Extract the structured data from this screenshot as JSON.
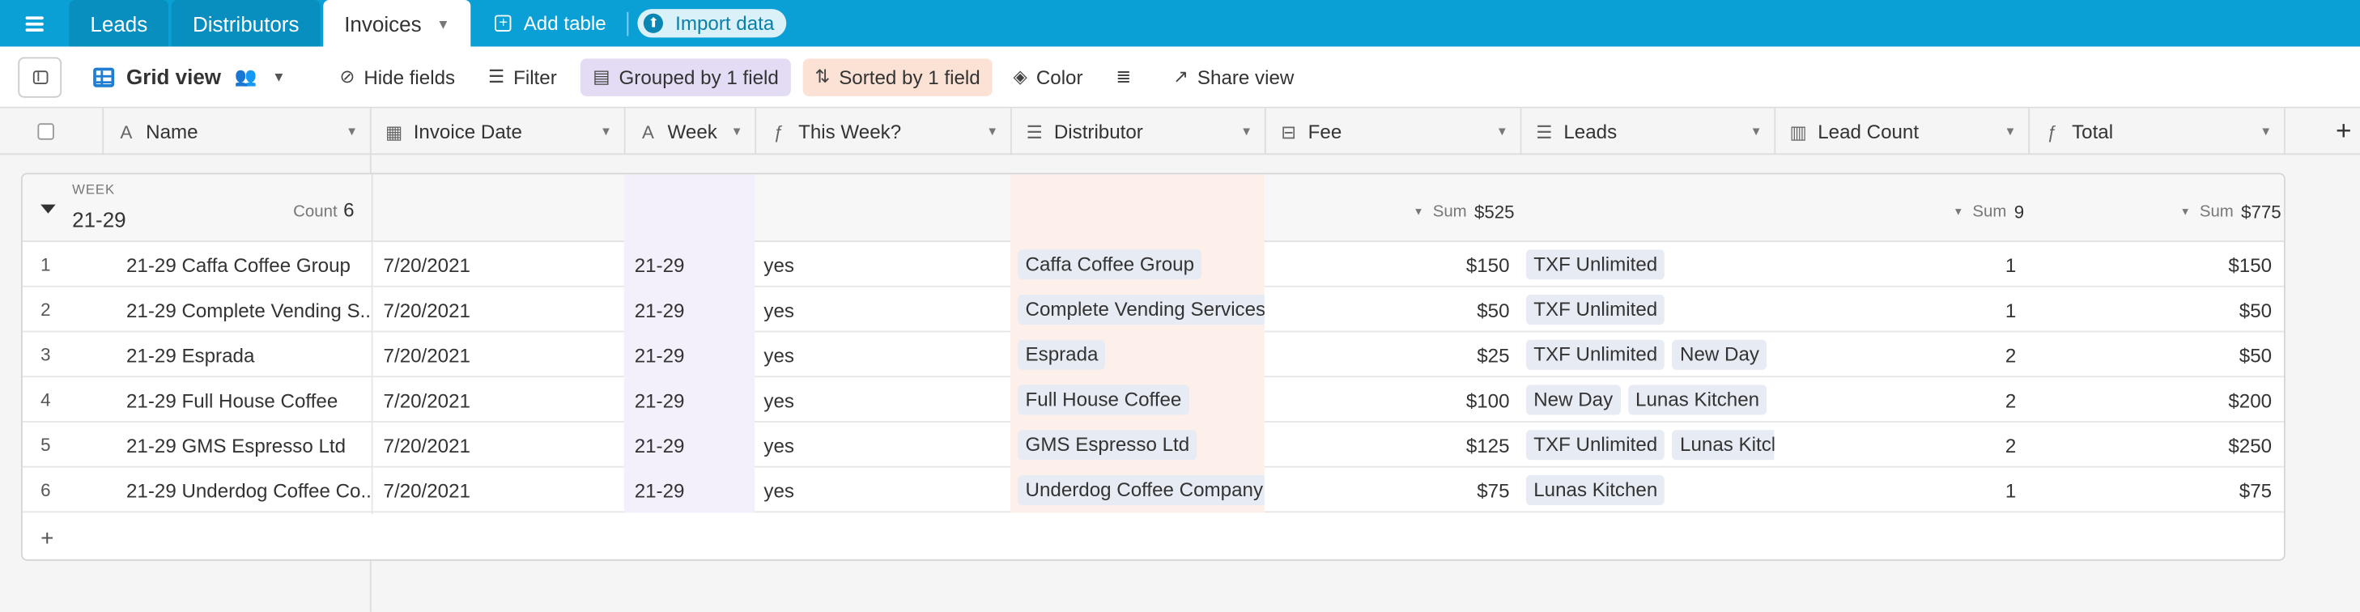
{
  "tabs": [
    {
      "label": "Leads"
    },
    {
      "label": "Distributors"
    },
    {
      "label": "Invoices"
    }
  ],
  "add_table_label": "Add table",
  "import_label": "Import data",
  "view": {
    "name": "Grid view",
    "hide_fields": "Hide fields",
    "filter": "Filter",
    "grouped": "Grouped by 1 field",
    "sorted": "Sorted by 1 field",
    "color": "Color",
    "share": "Share view"
  },
  "columns": {
    "name": "Name",
    "invoice_date": "Invoice Date",
    "week": "Week",
    "this_week": "This Week?",
    "distributor": "Distributor",
    "fee": "Fee",
    "leads": "Leads",
    "lead_count": "Lead Count",
    "total": "Total"
  },
  "group": {
    "label": "WEEK",
    "value": "21-29",
    "count_label": "Count",
    "count": "6",
    "sum_label": "Sum",
    "fee_sum": "$525",
    "lead_count_sum": "9",
    "total_sum": "$775"
  },
  "rows": [
    {
      "n": "1",
      "name": "21-29 Caffa Coffee Group",
      "date": "7/20/2021",
      "week": "21-29",
      "this_week": "yes",
      "distributor": "Caffa Coffee Group",
      "fee": "$150",
      "leads": [
        "TXF Unlimited"
      ],
      "lead_count": "1",
      "total": "$150"
    },
    {
      "n": "2",
      "name": "21-29 Complete Vending S...",
      "date": "7/20/2021",
      "week": "21-29",
      "this_week": "yes",
      "distributor": "Complete Vending Services",
      "fee": "$50",
      "leads": [
        "TXF Unlimited"
      ],
      "lead_count": "1",
      "total": "$50"
    },
    {
      "n": "3",
      "name": "21-29 Esprada",
      "date": "7/20/2021",
      "week": "21-29",
      "this_week": "yes",
      "distributor": "Esprada",
      "fee": "$25",
      "leads": [
        "TXF Unlimited",
        "New Day"
      ],
      "lead_count": "2",
      "total": "$50"
    },
    {
      "n": "4",
      "name": "21-29 Full House Coffee",
      "date": "7/20/2021",
      "week": "21-29",
      "this_week": "yes",
      "distributor": "Full House Coffee",
      "fee": "$100",
      "leads": [
        "New Day",
        "Lunas Kitchen"
      ],
      "lead_count": "2",
      "total": "$200"
    },
    {
      "n": "5",
      "name": "21-29 GMS Espresso Ltd",
      "date": "7/20/2021",
      "week": "21-29",
      "this_week": "yes",
      "distributor": "GMS Espresso Ltd",
      "fee": "$125",
      "leads": [
        "TXF Unlimited",
        "Lunas Kitchen"
      ],
      "lead_count": "2",
      "total": "$250"
    },
    {
      "n": "6",
      "name": "21-29 Underdog Coffee Co...",
      "date": "7/20/2021",
      "week": "21-29",
      "this_week": "yes",
      "distributor": "Underdog Coffee Company",
      "fee": "$75",
      "leads": [
        "Lunas Kitchen"
      ],
      "lead_count": "1",
      "total": "$75"
    }
  ],
  "colors": {
    "topbar": "#0aa0d6",
    "grouped_bg": "#e4dcf5",
    "sorted_bg": "#fbe2d5"
  }
}
